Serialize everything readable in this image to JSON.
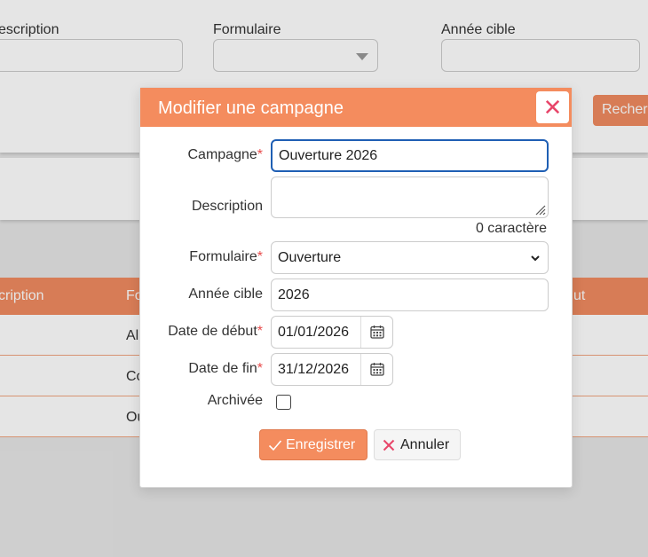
{
  "background": {
    "filters": {
      "description_label": "escription",
      "formulaire_label": "Formulaire",
      "annee_label": "Année cible"
    },
    "search_button": "Recher",
    "table": {
      "col1": "cription",
      "col2": "Fo",
      "col3": "ut",
      "rows": [
        "Al",
        "Co",
        "Ou"
      ]
    }
  },
  "modal": {
    "title": "Modifier une campagne",
    "close_symbol": "✕",
    "fields": {
      "campagne": {
        "label": "Campagne",
        "required": "*",
        "value": "Ouverture 2026"
      },
      "description": {
        "label": "Description",
        "value": "",
        "char_count": "0 caractère"
      },
      "formulaire": {
        "label": "Formulaire",
        "required": "*",
        "value": "Ouverture"
      },
      "annee": {
        "label": "Année cible",
        "value": "2026"
      },
      "date_debut": {
        "label": "Date de début",
        "required": "*",
        "value": "01/01/2026"
      },
      "date_fin": {
        "label": "Date de fin",
        "required": "*",
        "value": "31/12/2026"
      },
      "archivee": {
        "label": "Archivée",
        "checked": false
      }
    },
    "buttons": {
      "save": "Enregistrer",
      "cancel": "Annuler"
    }
  },
  "colors": {
    "accent": "#f48c5e",
    "required": "#e84c4c",
    "close_icon": "#e8466a",
    "focus_border": "#1f5fb4"
  },
  "icons": [
    "close-icon",
    "calendar-icon",
    "check-icon",
    "x-icon",
    "chevron-down-icon",
    "resize-handle-icon"
  ]
}
